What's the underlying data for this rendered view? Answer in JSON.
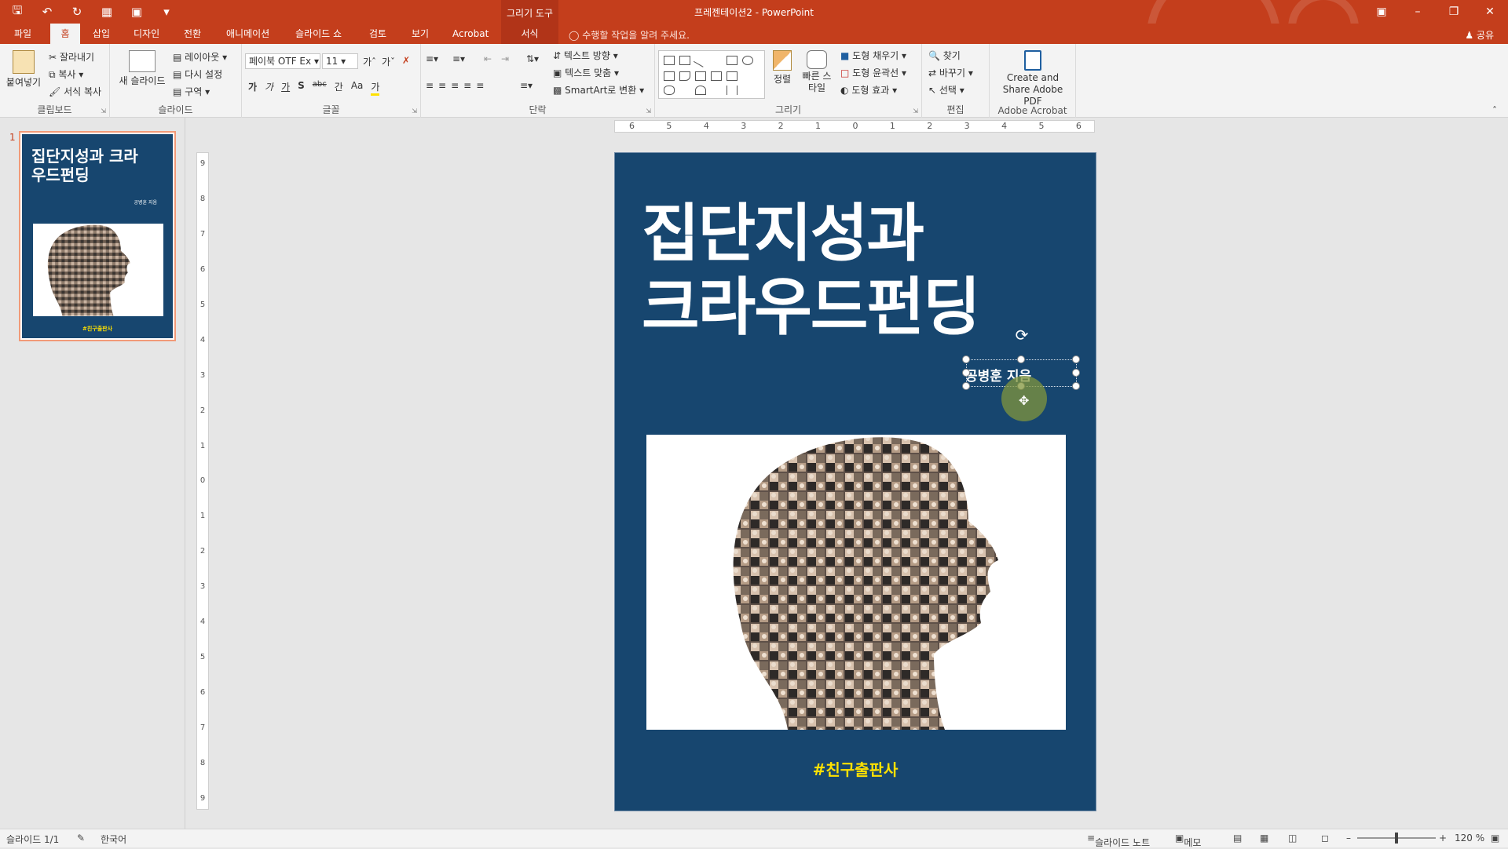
{
  "window": {
    "title": "프레젠테이션2 - PowerPoint",
    "context_tools": "그리기 도구"
  },
  "tabs": [
    {
      "label": "파일"
    },
    {
      "label": "홈"
    },
    {
      "label": "삽입"
    },
    {
      "label": "디자인"
    },
    {
      "label": "전환"
    },
    {
      "label": "애니메이션"
    },
    {
      "label": "슬라이드 쇼"
    },
    {
      "label": "검토"
    },
    {
      "label": "보기"
    },
    {
      "label": "Acrobat"
    },
    {
      "label": "서식"
    }
  ],
  "tell_me": "수행할 작업을 알려 주세요.",
  "share": "공유",
  "ribbon": {
    "clipboard": {
      "label": "클립보드",
      "paste": "붙여넣기",
      "cut": "잘라내기",
      "copy": "복사",
      "format_painter": "서식 복사"
    },
    "slides": {
      "label": "슬라이드",
      "new_slide": "새 슬라이드",
      "layout": "레이아웃",
      "reset": "다시 설정",
      "section": "구역"
    },
    "font": {
      "label": "글꼴",
      "font_name": "페이북 OTF Ex",
      "font_size": "11",
      "bold": "가",
      "italic": "가",
      "underline": "가",
      "shadow": "S",
      "strike": "abc",
      "spacing": "간",
      "case": "Aa",
      "color": "가"
    },
    "paragraph": {
      "label": "단락",
      "text_direction": "텍스트 방향",
      "align_text": "텍스트 맞춤",
      "smartart": "SmartArt로 변환"
    },
    "drawing": {
      "label": "그리기",
      "arrange": "정렬",
      "quick_styles": "빠른 스타일",
      "fill": "도형 채우기",
      "outline": "도형 윤곽선",
      "effects": "도형 효과"
    },
    "editing": {
      "label": "편집",
      "find": "찾기",
      "replace": "바꾸기",
      "select": "선택"
    },
    "acrobat": {
      "label": "Adobe Acrobat",
      "create_share": "Create and Share Adobe PDF"
    }
  },
  "thumbnail": {
    "number": "1",
    "title": "집단지성과 크라우드펀딩",
    "author": "공병훈 지음",
    "publisher": "#친구출판사"
  },
  "slide": {
    "title_line1": "집단지성과",
    "title_line2": "크라우드펀딩",
    "author": "공병훈 지음",
    "publisher": "#친구출판사",
    "background": "#17466f",
    "publisher_color": "#ffe100"
  },
  "hruler_ticks": [
    "6",
    "5",
    "4",
    "3",
    "2",
    "1",
    "0",
    "1",
    "2",
    "3",
    "4",
    "5",
    "6"
  ],
  "vruler_ticks": [
    "9",
    "8",
    "7",
    "6",
    "5",
    "4",
    "3",
    "2",
    "1",
    "0",
    "1",
    "2",
    "3",
    "4",
    "5",
    "6",
    "7",
    "8",
    "9"
  ],
  "status": {
    "slide_count": "슬라이드 1/1",
    "language": "한국어",
    "notes": "슬라이드 노트",
    "comments": "메모",
    "zoom": "120 %"
  },
  "accent": "#c43e1c"
}
